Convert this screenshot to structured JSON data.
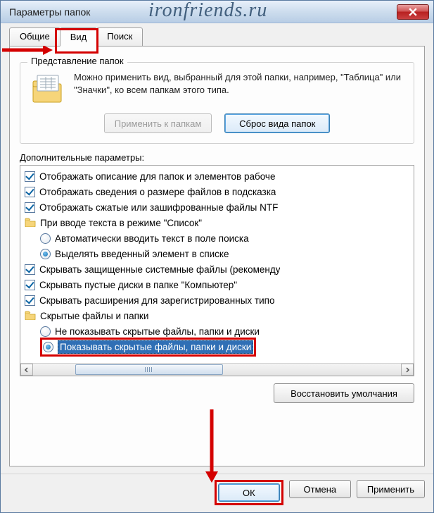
{
  "window": {
    "title": "Параметры папок",
    "watermark": "ironfriends.ru"
  },
  "tabs": {
    "general": "Общие",
    "view": "Вид",
    "search": "Поиск"
  },
  "folderview": {
    "legend": "Представление папок",
    "text": "Можно применить вид, выбранный для этой папки, например, \"Таблица\" или \"Значки\", ко всем папкам этого типа.",
    "apply_btn": "Применить к папкам",
    "reset_btn": "Сброс вида папок"
  },
  "advanced": {
    "label": "Дополнительные параметры:",
    "items": [
      {
        "type": "check",
        "level": 1,
        "checked": true,
        "label": "Отображать описание для папок и элементов рабоче"
      },
      {
        "type": "check",
        "level": 1,
        "checked": true,
        "label": "Отображать сведения о размере файлов в подсказка"
      },
      {
        "type": "check",
        "level": 1,
        "checked": true,
        "label": "Отображать сжатые или зашифрованные файлы NTF"
      },
      {
        "type": "folder",
        "level": 1,
        "label": "При вводе текста в режиме \"Список\""
      },
      {
        "type": "radio",
        "level": 2,
        "checked": false,
        "label": "Автоматически вводить текст в поле поиска"
      },
      {
        "type": "radio",
        "level": 2,
        "checked": true,
        "label": "Выделять введенный элемент в списке"
      },
      {
        "type": "check",
        "level": 1,
        "checked": true,
        "label": "Скрывать защищенные системные файлы (рекоменду"
      },
      {
        "type": "check",
        "level": 1,
        "checked": true,
        "label": "Скрывать пустые диски в папке \"Компьютер\""
      },
      {
        "type": "check",
        "level": 1,
        "checked": true,
        "label": "Скрывать расширения для зарегистрированных типо"
      },
      {
        "type": "folder",
        "level": 1,
        "label": "Скрытые файлы и папки"
      },
      {
        "type": "radio",
        "level": 2,
        "checked": false,
        "label": "Не показывать скрытые файлы, папки и диски"
      },
      {
        "type": "radio",
        "level": 2,
        "checked": true,
        "label": "Показывать скрытые файлы, папки и диски",
        "selected": true,
        "highlight": true
      }
    ],
    "restore_btn": "Восстановить умолчания"
  },
  "buttons": {
    "ok": "ОК",
    "cancel": "Отмена",
    "apply": "Применить"
  }
}
